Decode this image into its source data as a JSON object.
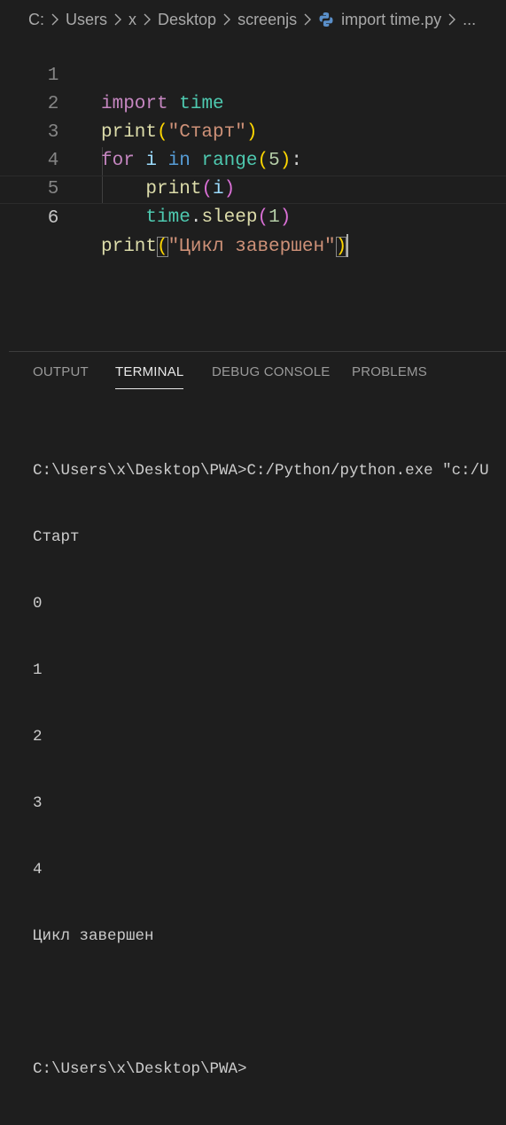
{
  "breadcrumb": {
    "items": [
      "C:",
      "Users",
      "x",
      "Desktop",
      "screenjs"
    ],
    "file": "import time.py",
    "trailing": "..."
  },
  "editor": {
    "line_numbers": [
      "1",
      "2",
      "3",
      "4",
      "5",
      "6"
    ],
    "lines": [
      [
        {
          "t": "import",
          "c": "kw-import"
        },
        {
          "t": " ",
          "c": "plain"
        },
        {
          "t": "time",
          "c": "mod"
        }
      ],
      [
        {
          "t": "print",
          "c": "fn"
        },
        {
          "t": "(",
          "c": "p1"
        },
        {
          "t": "\"Старт\"",
          "c": "str"
        },
        {
          "t": ")",
          "c": "p1"
        }
      ],
      [
        {
          "t": "for",
          "c": "kw-ctl"
        },
        {
          "t": " ",
          "c": "plain"
        },
        {
          "t": "i",
          "c": "var"
        },
        {
          "t": " ",
          "c": "plain"
        },
        {
          "t": "in",
          "c": "kw-blue"
        },
        {
          "t": " ",
          "c": "plain"
        },
        {
          "t": "range",
          "c": "mod"
        },
        {
          "t": "(",
          "c": "p1"
        },
        {
          "t": "5",
          "c": "num"
        },
        {
          "t": ")",
          "c": "p1"
        },
        {
          "t": ":",
          "c": "plain"
        }
      ],
      [
        {
          "t": "    ",
          "c": "plain"
        },
        {
          "t": "print",
          "c": "fn"
        },
        {
          "t": "(",
          "c": "p2"
        },
        {
          "t": "i",
          "c": "var"
        },
        {
          "t": ")",
          "c": "p2"
        }
      ],
      [
        {
          "t": "    ",
          "c": "plain"
        },
        {
          "t": "time",
          "c": "mod"
        },
        {
          "t": ".",
          "c": "plain"
        },
        {
          "t": "sleep",
          "c": "fn"
        },
        {
          "t": "(",
          "c": "p2"
        },
        {
          "t": "1",
          "c": "num"
        },
        {
          "t": ")",
          "c": "p2"
        }
      ],
      [
        {
          "t": "print",
          "c": "fn"
        },
        {
          "t": "(",
          "c": "p1 match"
        },
        {
          "t": "\"Цикл завершен\"",
          "c": "str"
        },
        {
          "t": ")",
          "c": "p1 match"
        }
      ]
    ]
  },
  "panel": {
    "tabs": [
      {
        "label": "OUTPUT",
        "active": false
      },
      {
        "label": "TERMINAL",
        "active": true
      },
      {
        "label": "DEBUG CONSOLE",
        "active": false
      },
      {
        "label": "PROBLEMS",
        "active": false
      }
    ],
    "terminal_lines": [
      "C:\\Users\\x\\Desktop\\PWA>C:/Python/python.exe \"c:/U",
      "Старт",
      "0",
      "1",
      "2",
      "3",
      "4",
      "Цикл завершен",
      "",
      "C:\\Users\\x\\Desktop\\PWA>"
    ]
  },
  "colors": {
    "background": "#1e1e1e",
    "keyword": "#c586c0",
    "function": "#dcdcaa",
    "module": "#4ec9b0",
    "string": "#ce9178",
    "number": "#b5cea8"
  }
}
